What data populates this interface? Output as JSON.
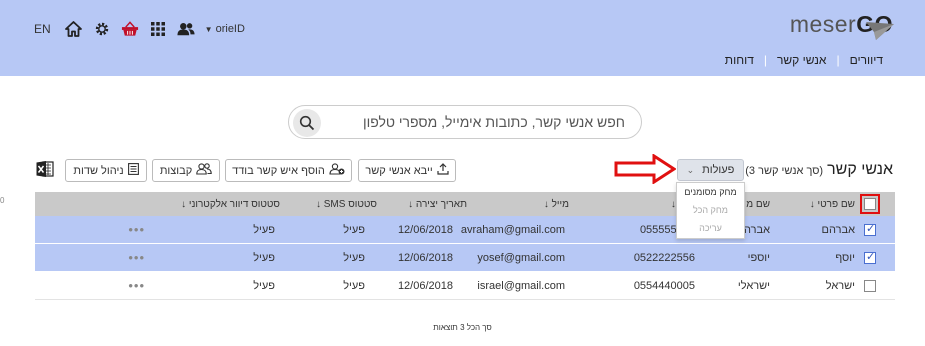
{
  "header": {
    "lang": "EN",
    "user": "orieID",
    "logo_light": "meser",
    "logo_bold": "GO",
    "nav": [
      "דיוורים",
      "אנשי קשר",
      "דוחות"
    ],
    "icons": [
      "home-icon",
      "gear-icon",
      "basket-icon",
      "apps-grid-icon",
      "users-icon"
    ]
  },
  "search": {
    "placeholder": "חפש אנשי קשר, כתובות אימייל, מספרי טלפון"
  },
  "toolbar": {
    "title": "אנשי קשר",
    "count": "(סך אנשי קשר 3)",
    "actions": "פעולות",
    "import": "ייבא אנשי קשר",
    "add_single": "הוסף איש קשר בודד",
    "groups": "קבוצות",
    "manage_fields": "ניהול שדות"
  },
  "dropdown": {
    "items": [
      "מחק מסומנים",
      "מחק הכל",
      "עריכה"
    ]
  },
  "table": {
    "columns": {
      "first_name": "שם פרטי ↓",
      "last_name": "שם מ",
      "phone": "לפון ↓",
      "email": "מייל ↓",
      "created": "תאריך יצירה ↓",
      "sms": "סטטוס SMS ↓",
      "email_status": "סטטוס דיוור אלקטרוני ↓"
    },
    "rows": [
      {
        "selected": true,
        "first_name": "אברהם",
        "last_name": "אברה",
        "phone": "055555666",
        "email": "avraham@gmail.com",
        "created": "12/06/2018",
        "sms": "פעיל",
        "email_status": "פעיל",
        "more": "•••"
      },
      {
        "selected": true,
        "first_name": "יוסף",
        "last_name": "יוספי",
        "phone": "0522222556",
        "email": "yosef@gmail.com",
        "created": "12/06/2018",
        "sms": "פעיל",
        "email_status": "פעיל",
        "more": "•••"
      },
      {
        "selected": false,
        "first_name": "ישראל",
        "last_name": "ישראלי",
        "phone": "0554440005",
        "email": "israel@gmail.com",
        "created": "12/06/2018",
        "sms": "פעיל",
        "email_status": "פעיל",
        "more": "•••"
      }
    ]
  },
  "footer": "סך הכל 3 תוצאות",
  "edge_mark": "0",
  "colors": {
    "header_bg": "#b7c8f5",
    "selected_row": "#b7c8f5",
    "table_header": "#c9c9c9",
    "highlight_red": "#e01010"
  }
}
